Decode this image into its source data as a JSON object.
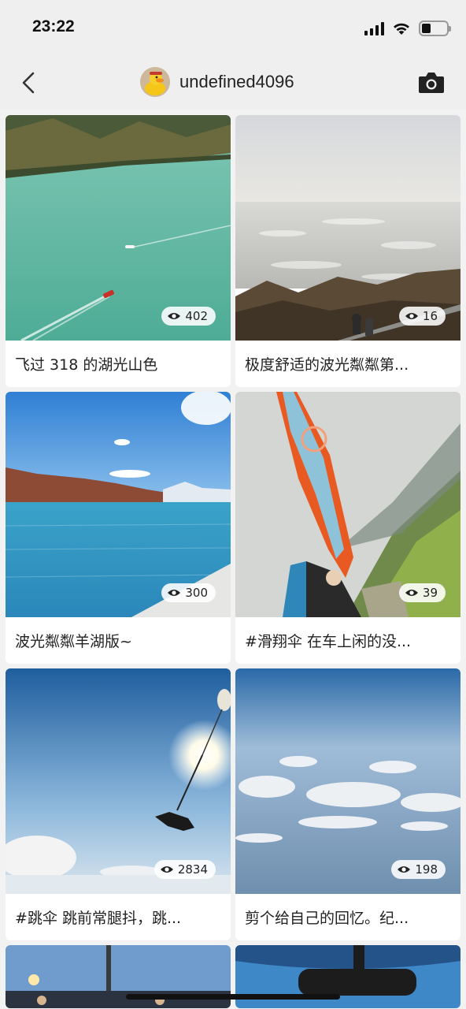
{
  "status_bar": {
    "time": "23:22"
  },
  "nav": {
    "username": "undefined4096"
  },
  "icons": {
    "back": "chevron-left-icon",
    "camera": "camera-icon",
    "views": "eye-icon",
    "signal": "cellular-signal-icon",
    "wifi": "wifi-icon",
    "battery": "battery-icon"
  },
  "status": {
    "battery_level_fraction": 0.35
  },
  "posts": [
    {
      "views": "402",
      "caption": "飞过 318 的湖光山色"
    },
    {
      "views": "16",
      "caption": "极度舒适的波光粼粼第..."
    },
    {
      "views": "300",
      "caption": "波光粼粼羊湖版~"
    },
    {
      "views": "39",
      "caption": "#滑翔伞 在车上闲的没..."
    },
    {
      "views": "2834",
      "caption": "#跳伞 跳前常腿抖，跳..."
    },
    {
      "views": "198",
      "caption": "剪个给自己的回忆。纪..."
    }
  ]
}
